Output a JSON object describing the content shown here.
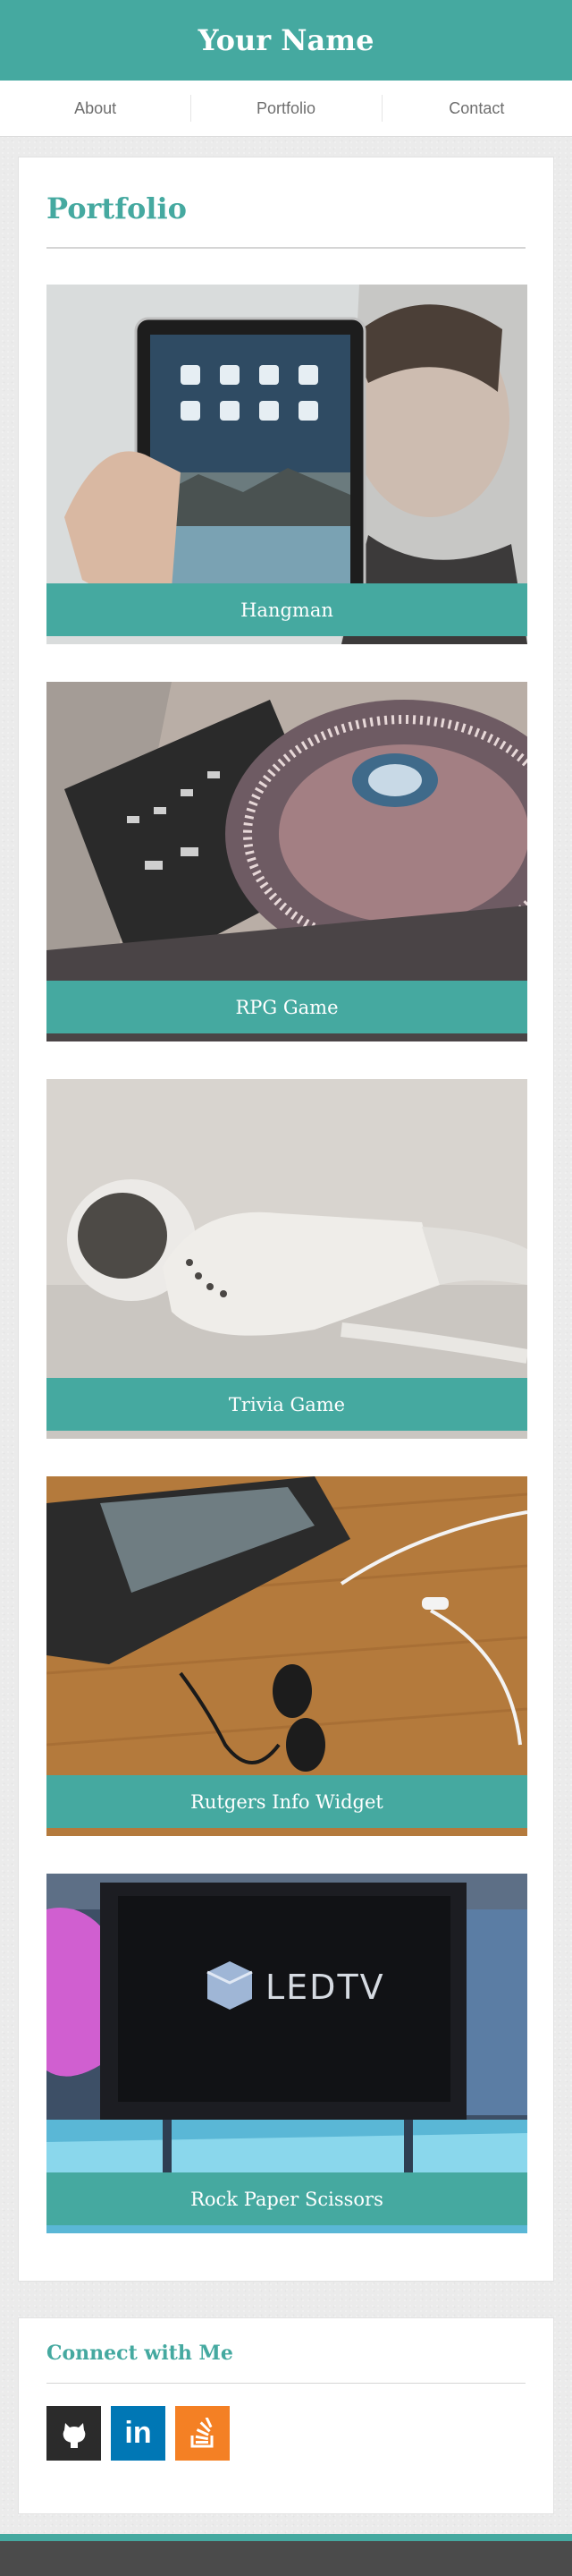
{
  "header": {
    "title": "Your Name"
  },
  "nav": {
    "items": [
      "About",
      "Portfolio",
      "Contact"
    ]
  },
  "portfolio": {
    "heading": "Portfolio",
    "items": [
      {
        "caption": "Hangman",
        "image": "tablet-photo"
      },
      {
        "caption": "RPG Game",
        "image": "dj-turntable-photo"
      },
      {
        "caption": "Trivia Game",
        "image": "earbuds-photo"
      },
      {
        "caption": "Rutgers Info Widget",
        "image": "phone-earphones-photo"
      },
      {
        "caption": "Rock Paper Scissors",
        "image": "led-tv-photo",
        "tv_text": "LEDTV"
      }
    ]
  },
  "connect": {
    "heading": "Connect with Me",
    "links": [
      {
        "icon": "github-icon",
        "color": "#2b2b2b"
      },
      {
        "icon": "linkedin-icon",
        "color": "#0077b5",
        "text": "in"
      },
      {
        "icon": "stackoverflow-icon",
        "color": "#f48024"
      }
    ]
  },
  "colors": {
    "accent": "#45a9a0",
    "footer": "#4b4b4b"
  }
}
